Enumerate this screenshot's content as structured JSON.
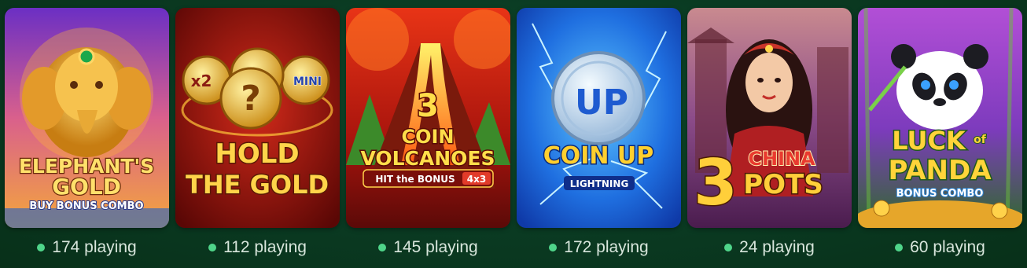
{
  "games": [
    {
      "title_line1": "ELEPHANT'S",
      "title_line2": "GOLD",
      "subtitle": "BUY BONUS COMBO",
      "players": "174 playing"
    },
    {
      "title_line1": "HOLD",
      "title_line2": "THE GOLD",
      "coin_label_left": "x2",
      "coin_label_right": "MINI",
      "coin_label_center": "?",
      "players": "112 playing"
    },
    {
      "title_num": "3",
      "title_line1": "COIN",
      "title_line2": "VOLCANOES",
      "badge": "HIT the BONUS",
      "badge_mult": "4x3",
      "players": "145 playing"
    },
    {
      "coin_label": "UP",
      "title_line1": "COIN UP",
      "subtitle": "LIGHTNING",
      "players": "172 playing"
    },
    {
      "title_num": "3",
      "title_line1": "CHINA",
      "title_line2": "POTS",
      "players": "24 playing"
    },
    {
      "title_line1": "LUCK",
      "title_small": "of",
      "title_line2": "PANDA",
      "subtitle": "BONUS COMBO",
      "players": "60 playing"
    }
  ],
  "colors": {
    "online_dot": "#4fd58a",
    "page_bg": "#0b3d24"
  }
}
